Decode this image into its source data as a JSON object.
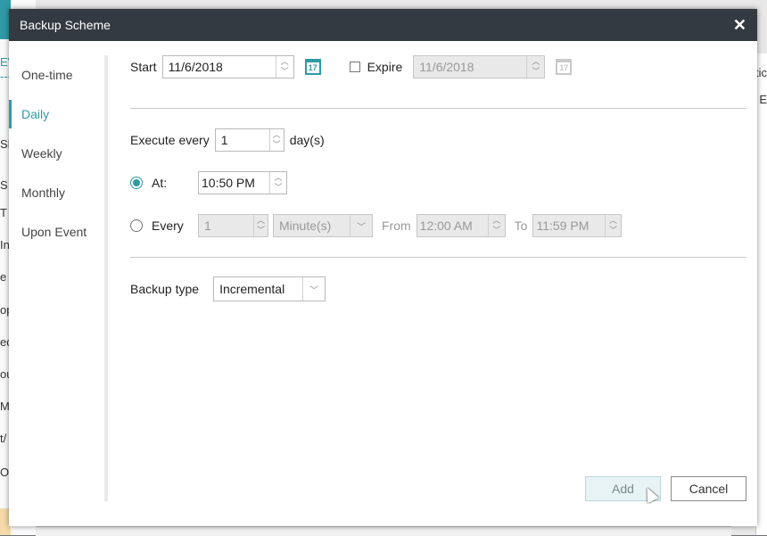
{
  "background": {
    "left_fragments": [
      "EV",
      "---",
      "SE",
      "S",
      "T",
      "In",
      "e B",
      "op",
      "ed",
      "ou",
      "Ma",
      "t/",
      "OR"
    ],
    "right_fragments": [
      "tic",
      "y E"
    ]
  },
  "dialog": {
    "title": "Backup Scheme",
    "close_icon": "close-icon"
  },
  "sidebar": {
    "items": [
      {
        "label": "One-time"
      },
      {
        "label": "Daily",
        "active": true
      },
      {
        "label": "Weekly"
      },
      {
        "label": "Monthly"
      },
      {
        "label": "Upon Event"
      }
    ]
  },
  "dates": {
    "start_label": "Start",
    "start_value": "11/6/2018",
    "expire_label": "Expire",
    "expire_value": "11/6/2018",
    "expire_checked": false,
    "calendar_icon_text": "17"
  },
  "schedule": {
    "execute_every_label": "Execute every",
    "execute_every_value": "1",
    "execute_every_unit": "day(s)",
    "at_label": "At:",
    "at_value": "10:50 PM",
    "at_selected": true,
    "every_label": "Every",
    "every_value": "1",
    "every_unit": "Minute(s)",
    "from_label": "From",
    "from_value": "12:00 AM",
    "to_label": "To",
    "to_value": "11:59 PM"
  },
  "backup": {
    "type_label": "Backup type",
    "type_value": "Incremental"
  },
  "buttons": {
    "add": "Add",
    "cancel": "Cancel"
  },
  "colors": {
    "accent": "#2f9aa6",
    "titlebar": "#333a42"
  }
}
